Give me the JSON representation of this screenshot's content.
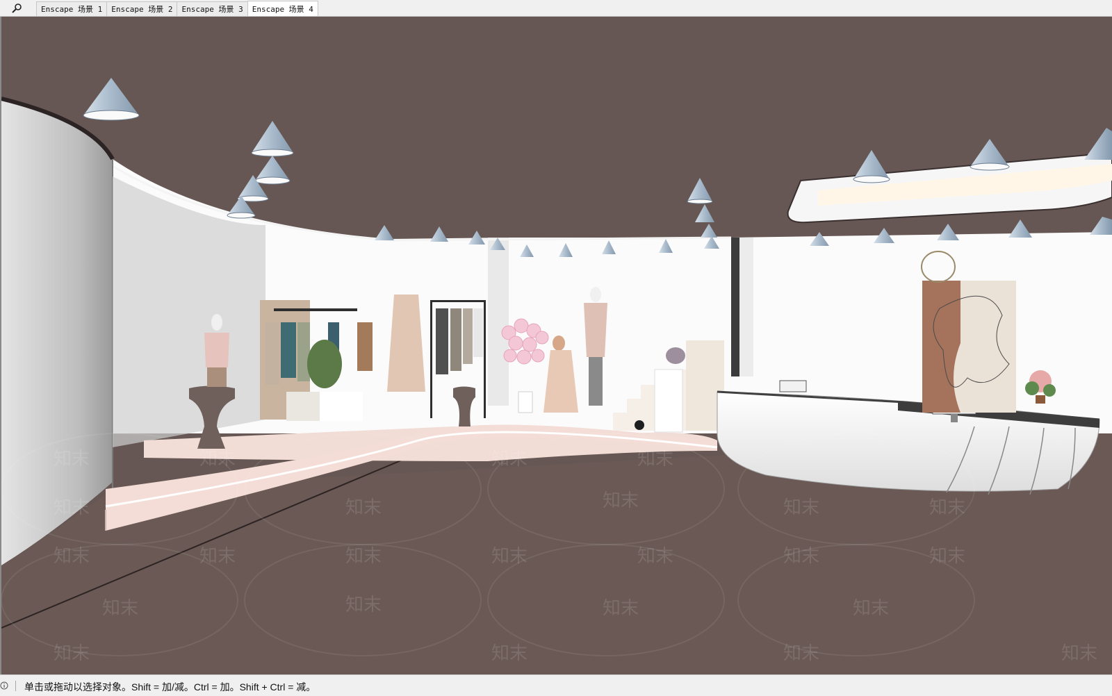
{
  "toolbar": {
    "search_icon": "search-icon",
    "tabs": [
      {
        "label": "Enscape 场景 1",
        "active": false
      },
      {
        "label": "Enscape 场景 2",
        "active": false
      },
      {
        "label": "Enscape 场景 3",
        "active": false
      },
      {
        "label": "Enscape 场景 4",
        "active": true
      }
    ]
  },
  "viewport": {
    "ceiling_color": "#665754",
    "floor_color": "#6a5955",
    "wall_color": "#fafafa",
    "accent_pink": "#f0d6d0",
    "lamp_color": "#b3c3d4",
    "watermark_text": "知末"
  },
  "statusbar": {
    "info_icon": "info-icon",
    "message": "单击或拖动以选择对象。Shift = 加/减。Ctrl = 加。Shift + Ctrl = 减。"
  }
}
